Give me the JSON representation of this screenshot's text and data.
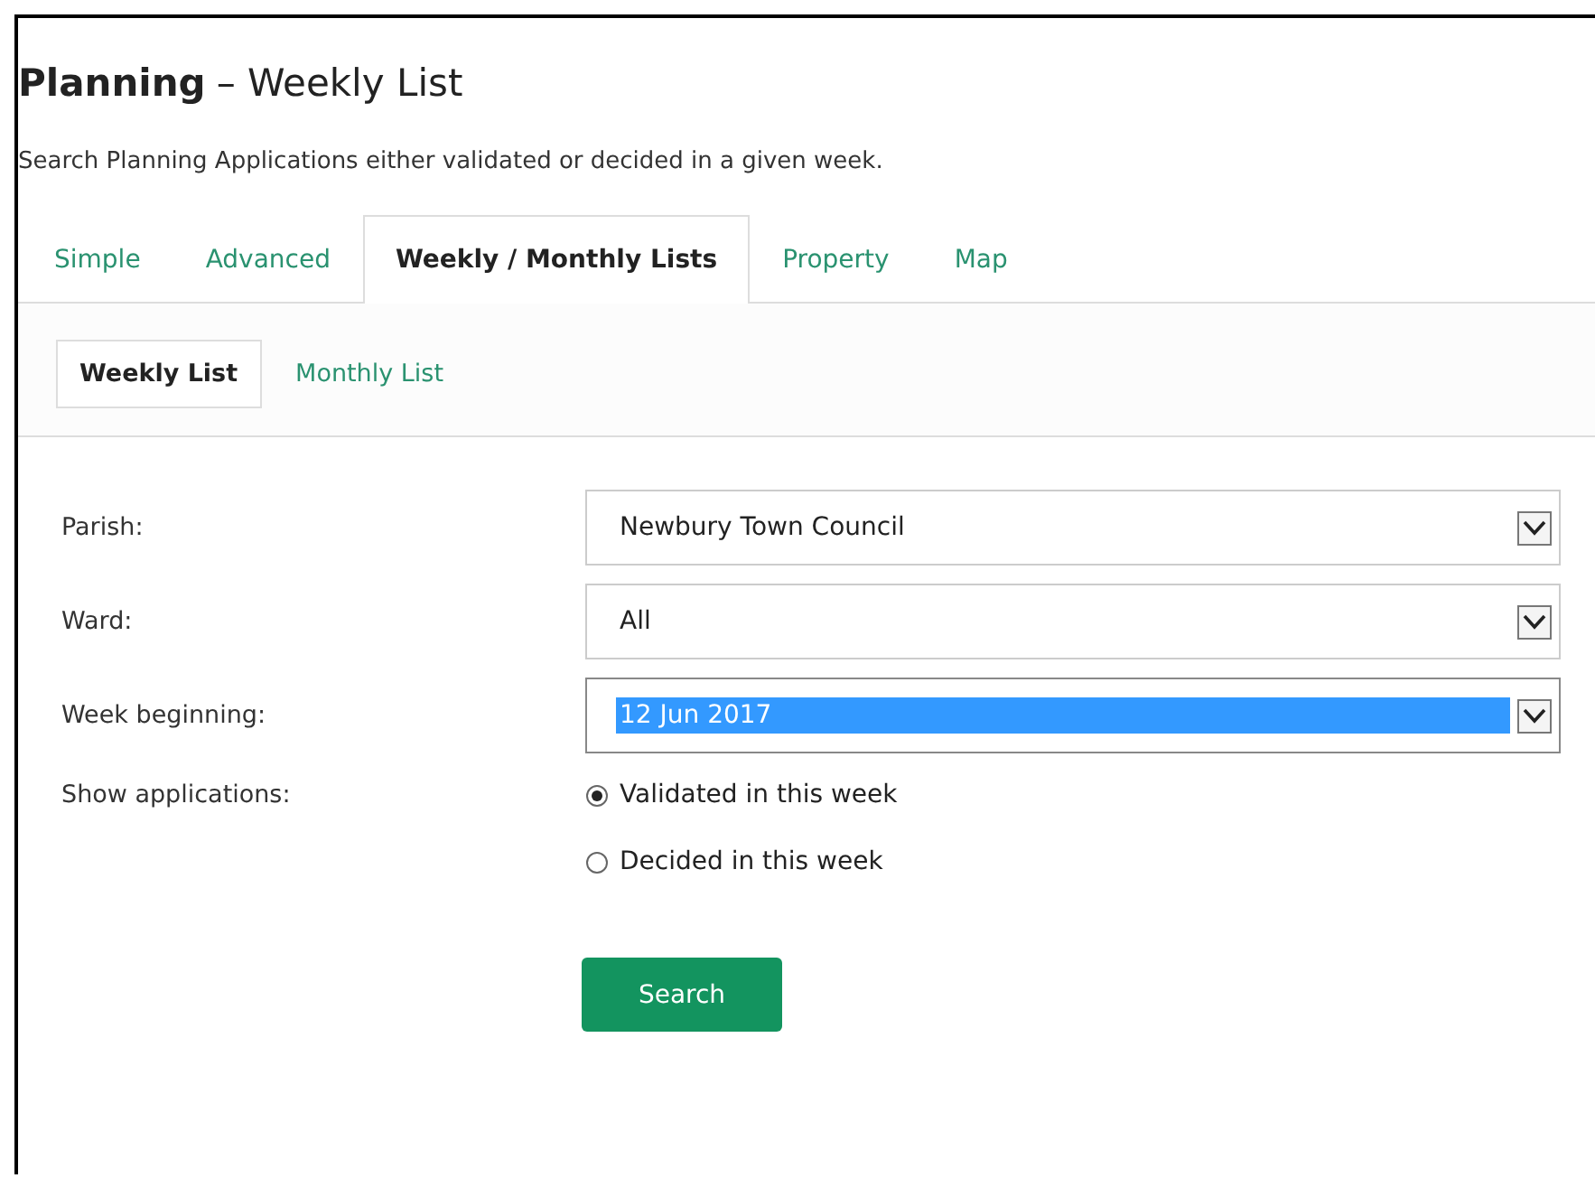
{
  "heading": {
    "title": "Planning",
    "subtitle": "– Weekly List"
  },
  "description": "Search Planning Applications either validated or decided in a given week.",
  "tabs": [
    {
      "label": "Simple",
      "selected": false
    },
    {
      "label": "Advanced",
      "selected": false
    },
    {
      "label": "Weekly / Monthly Lists",
      "selected": true
    },
    {
      "label": "Property",
      "selected": false
    },
    {
      "label": "Map",
      "selected": false
    }
  ],
  "subtabs": [
    {
      "label": "Weekly List",
      "selected": true
    },
    {
      "label": "Monthly List",
      "selected": false
    }
  ],
  "fields": [
    {
      "label": "Parish:",
      "value": "Newbury Town Council",
      "highlighted": false
    },
    {
      "label": "Ward:",
      "value": "All",
      "highlighted": false
    },
    {
      "label": "Week beginning:",
      "value": "12 Jun 2017",
      "highlighted": true
    }
  ],
  "show_applications": {
    "label": "Show applications:",
    "options": [
      {
        "label": "Validated in this week",
        "selected": true
      },
      {
        "label": "Decided in this week",
        "selected": false
      }
    ]
  },
  "search_button": "Search"
}
